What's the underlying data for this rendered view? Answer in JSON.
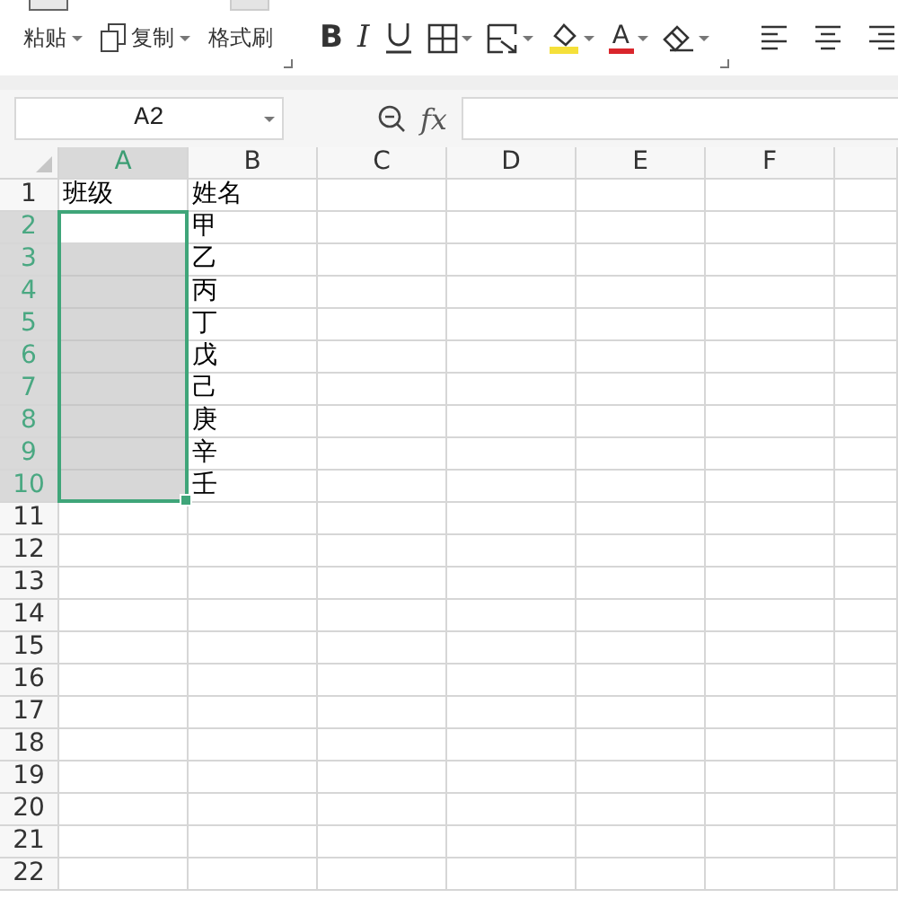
{
  "toolbar": {
    "clipboard": [
      {
        "kind": "paste",
        "label": "粘贴",
        "dropdown": true
      },
      {
        "kind": "copy",
        "label": "复制",
        "dropdown": true
      },
      {
        "kind": "painter",
        "label": "格式刷",
        "dropdown": false
      }
    ],
    "format": [
      {
        "kind": "bold",
        "label": "B",
        "dropdown": false
      },
      {
        "kind": "italic",
        "label": "I",
        "dropdown": false
      },
      {
        "kind": "underline",
        "dropdown": false
      },
      {
        "kind": "borders",
        "dropdown": true
      },
      {
        "kind": "merge",
        "dropdown": true
      },
      {
        "kind": "fill",
        "dropdown": true
      },
      {
        "kind": "font-color",
        "label": "A",
        "dropdown": true
      },
      {
        "kind": "clear",
        "dropdown": true
      }
    ],
    "align": [
      {
        "kind": "left"
      },
      {
        "kind": "center"
      },
      {
        "kind": "right"
      }
    ]
  },
  "formula_bar": {
    "name_box": "A2",
    "fx": "fx"
  },
  "sheet": {
    "columns": [
      {
        "label": "A",
        "selected": true
      },
      {
        "label": "B",
        "selected": false
      },
      {
        "label": "C",
        "selected": false
      },
      {
        "label": "D",
        "selected": false
      },
      {
        "label": "E",
        "selected": false
      },
      {
        "label": "F",
        "selected": false
      },
      {
        "selected": false
      }
    ],
    "rows": [
      {
        "number": "1",
        "selected": false,
        "cells": [
          "班级",
          "姓名"
        ]
      },
      {
        "number": "2",
        "selected": true,
        "cells": [
          "",
          "甲"
        ]
      },
      {
        "number": "3",
        "selected": true,
        "cells": [
          "",
          "乙"
        ]
      },
      {
        "number": "4",
        "selected": true,
        "cells": [
          "",
          "丙"
        ]
      },
      {
        "number": "5",
        "selected": true,
        "cells": [
          "",
          "丁"
        ]
      },
      {
        "number": "6",
        "selected": true,
        "cells": [
          "",
          "戊"
        ]
      },
      {
        "number": "7",
        "selected": true,
        "cells": [
          "",
          "己"
        ]
      },
      {
        "number": "8",
        "selected": true,
        "cells": [
          "",
          "庚"
        ]
      },
      {
        "number": "9",
        "selected": true,
        "cells": [
          "",
          "辛"
        ]
      },
      {
        "number": "10",
        "selected": true,
        "cells": [
          "",
          "壬"
        ]
      },
      {
        "number": "11",
        "selected": false
      },
      {
        "number": "12",
        "selected": false
      },
      {
        "number": "13",
        "selected": false
      },
      {
        "number": "14",
        "selected": false
      },
      {
        "number": "15",
        "selected": false
      },
      {
        "number": "16",
        "selected": false
      },
      {
        "number": "17",
        "selected": false
      },
      {
        "number": "18",
        "selected": false
      },
      {
        "number": "19",
        "selected": false
      },
      {
        "number": "20",
        "selected": false
      },
      {
        "number": "21",
        "selected": false
      },
      {
        "number": "22",
        "selected": false
      }
    ]
  }
}
